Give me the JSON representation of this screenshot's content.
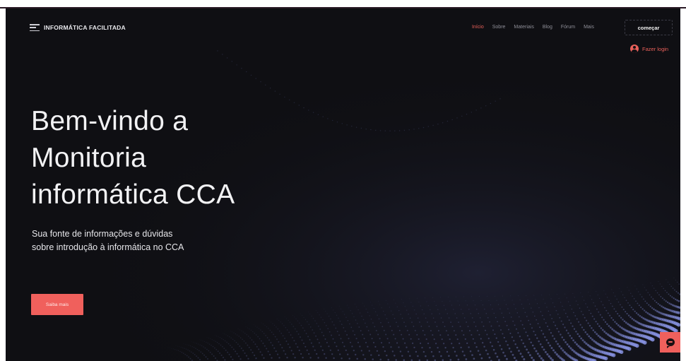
{
  "site": {
    "logo_text": "INFORMÁTICA FACILITADA"
  },
  "nav": {
    "items": [
      {
        "label": "Início",
        "active": true
      },
      {
        "label": "Sobre",
        "active": false
      },
      {
        "label": "Materiais",
        "active": false
      },
      {
        "label": "Blog",
        "active": false
      },
      {
        "label": "Fórum",
        "active": false
      },
      {
        "label": "Mais",
        "active": false
      }
    ],
    "cta_label": "começar",
    "login_label": "Fazer login"
  },
  "hero": {
    "title_line1": "Bem-vindo a",
    "title_line2": "Monitoria",
    "title_line3": "informática CCA",
    "subtitle": "Sua fonte de informações e dúvidas sobre introdução à informática no CCA",
    "button_label": "Saiba mais"
  },
  "icons": {
    "logo": "menu-lines-icon",
    "login": "user-avatar-icon",
    "chat": "chat-bubble-icon"
  },
  "colors": {
    "background": "#0f0f13",
    "accent": "#f0605c",
    "dots": "#8a95e6"
  }
}
